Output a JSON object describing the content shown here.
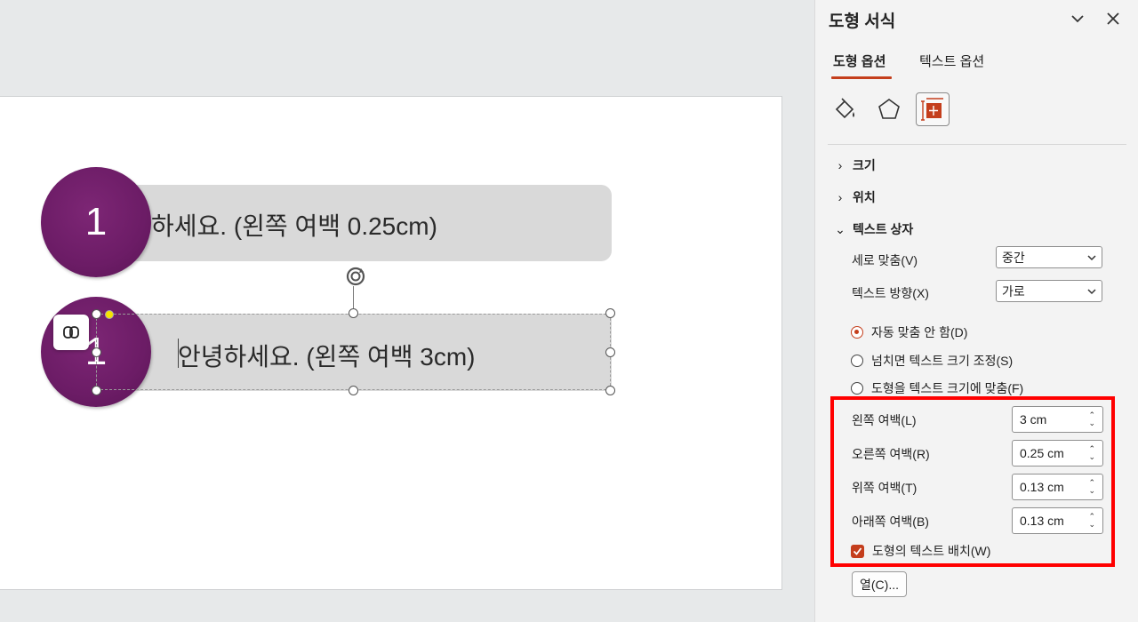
{
  "slide": {
    "item1": {
      "number": "1",
      "text": "하세요. (왼쪽 여백 0.25cm)"
    },
    "item2": {
      "number": "1",
      "text": "안녕하세요. (왼쪽 여백 3cm)"
    }
  },
  "pane": {
    "title": "도형 서식",
    "tabs": [
      {
        "label": "도형 옵션",
        "active": true
      },
      {
        "label": "텍스트 옵션",
        "active": false
      }
    ],
    "icon_tabs": [
      "fill-line-icon",
      "effects-pentagon-icon",
      "size-properties-icon"
    ],
    "sections": {
      "size": "크기",
      "position": "위치",
      "textbox": "텍스트 상자"
    },
    "vertical_align": {
      "label": "세로 맞춤(V)",
      "value": "중간"
    },
    "text_direction": {
      "label": "텍스트 방향(X)",
      "value": "가로"
    },
    "autofit": [
      {
        "label": "자동 맞춤 안 함(D)",
        "selected": true
      },
      {
        "label": "넘치면 텍스트 크기 조정(S)",
        "selected": false
      },
      {
        "label": "도형을 텍스트 크기에 맞춤(F)",
        "selected": false
      }
    ],
    "margins": {
      "left": {
        "label": "왼쪽 여백(L)",
        "value": "3 cm"
      },
      "right": {
        "label": "오른쪽 여백(R)",
        "value": "0.25 cm"
      },
      "top": {
        "label": "위쪽 여백(T)",
        "value": "0.13 cm"
      },
      "bottom": {
        "label": "아래쪽 여백(B)",
        "value": "0.13 cm"
      }
    },
    "wrap_text": {
      "label": "도형의 텍스트 배치(W)",
      "checked": true
    },
    "columns_button": "열(C)..."
  },
  "colors": {
    "accent": "#c43e1c",
    "highlight": "#ff0000",
    "circle": "#6c1c66",
    "bar": "#d9d9d9"
  }
}
